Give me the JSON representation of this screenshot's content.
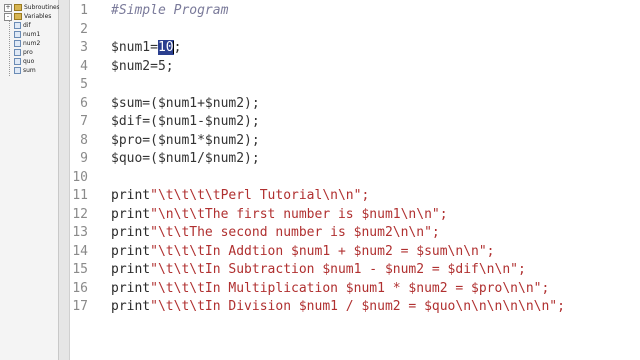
{
  "sidebar": {
    "items": [
      {
        "label": "Subroutines",
        "kind": "folder",
        "expanded": false
      },
      {
        "label": "Variables",
        "kind": "folder",
        "expanded": true
      },
      {
        "label": "dif",
        "kind": "leaf"
      },
      {
        "label": "num1",
        "kind": "leaf"
      },
      {
        "label": "num2",
        "kind": "leaf"
      },
      {
        "label": "pro",
        "kind": "leaf"
      },
      {
        "label": "quo",
        "kind": "leaf"
      },
      {
        "label": "sum",
        "kind": "leaf"
      }
    ]
  },
  "editor": {
    "lines": [
      {
        "n": "1",
        "parts": [
          {
            "t": "#Simple Program",
            "c": "comment"
          }
        ]
      },
      {
        "n": "2",
        "parts": []
      },
      {
        "n": "3",
        "parts": [
          {
            "t": "$num1=",
            "c": "var"
          },
          {
            "t": "10",
            "c": "sel"
          },
          {
            "t": ";",
            "c": "kw"
          }
        ]
      },
      {
        "n": "4",
        "parts": [
          {
            "t": "$num2=5;",
            "c": "var"
          }
        ]
      },
      {
        "n": "5",
        "parts": []
      },
      {
        "n": "6",
        "parts": [
          {
            "t": "$sum=($num1+$num2);",
            "c": "var"
          }
        ]
      },
      {
        "n": "7",
        "parts": [
          {
            "t": "$dif=($num1-$num2);",
            "c": "var"
          }
        ]
      },
      {
        "n": "8",
        "parts": [
          {
            "t": "$pro=($num1*$num2);",
            "c": "var"
          }
        ]
      },
      {
        "n": "9",
        "parts": [
          {
            "t": "$quo=($num1/$num2);",
            "c": "var"
          }
        ]
      },
      {
        "n": "10",
        "parts": []
      },
      {
        "n": "11",
        "parts": [
          {
            "t": "print",
            "c": "kw"
          },
          {
            "t": "\"\\t\\t\\t\\tPerl Tutorial\\n\\n\";",
            "c": "str"
          }
        ]
      },
      {
        "n": "12",
        "parts": [
          {
            "t": "print",
            "c": "kw"
          },
          {
            "t": "\"\\n\\t\\tThe first number is $num1\\n\\n\";",
            "c": "str"
          }
        ]
      },
      {
        "n": "13",
        "parts": [
          {
            "t": "print",
            "c": "kw"
          },
          {
            "t": "\"\\t\\tThe second number is $num2\\n\\n\";",
            "c": "str"
          }
        ]
      },
      {
        "n": "14",
        "parts": [
          {
            "t": "print",
            "c": "kw"
          },
          {
            "t": "\"\\t\\t\\tIn Addtion $num1 + $num2 = $sum\\n\\n\";",
            "c": "str"
          }
        ]
      },
      {
        "n": "15",
        "parts": [
          {
            "t": "print",
            "c": "kw"
          },
          {
            "t": "\"\\t\\t\\tIn Subtraction $num1 - $num2 = $dif\\n\\n\";",
            "c": "str"
          }
        ]
      },
      {
        "n": "16",
        "parts": [
          {
            "t": "print",
            "c": "kw"
          },
          {
            "t": "\"\\t\\t\\tIn Multiplication $num1 * $num2 = $pro\\n\\n\";",
            "c": "str"
          }
        ]
      },
      {
        "n": "17",
        "parts": [
          {
            "t": "print",
            "c": "kw"
          },
          {
            "t": "\"\\t\\t\\tIn Division $num1 / $num2 = $quo\\n\\n\\n\\n\\n\\n\";",
            "c": "str"
          }
        ]
      }
    ]
  },
  "colors": {
    "string": "#b03030",
    "comment": "#7a7a9a",
    "selection": "#2b3f8f"
  }
}
